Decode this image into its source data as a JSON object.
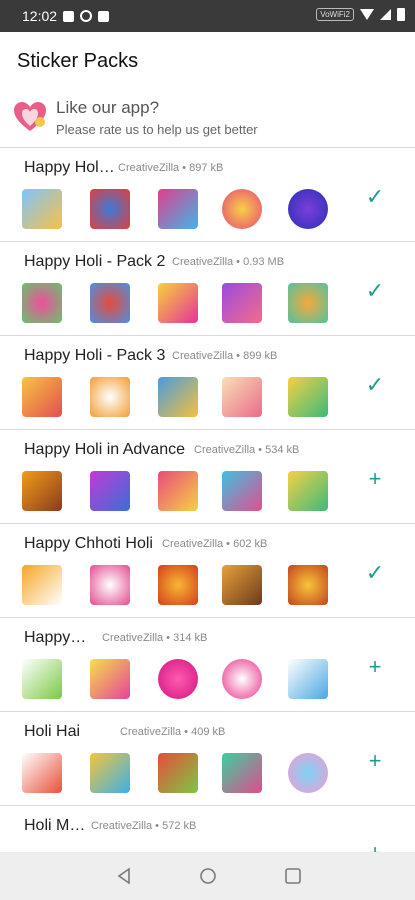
{
  "status_bar": {
    "time": "12:02",
    "vowifi": "VoWiFi2"
  },
  "app_bar": {
    "title": "Sticker Packs"
  },
  "rate_prompt": {
    "title": "Like our app?",
    "subtitle": "Please rate us to help us get better"
  },
  "packs": [
    {
      "title": "Happy Hol…",
      "meta": "CreativeZilla • 897 kB",
      "action": "✓"
    },
    {
      "title": "Happy Holi - Pack 2",
      "meta": "CreativeZilla • 0.93 MB",
      "action": "✓"
    },
    {
      "title": "Happy Holi - Pack 3",
      "meta": "CreativeZilla • 899 kB",
      "action": "✓"
    },
    {
      "title": "Happy Holi in Advance",
      "meta": "CreativeZilla • 534 kB",
      "action": "+"
    },
    {
      "title": "Happy Chhoti Holi",
      "meta": "CreativeZilla • 602 kB",
      "action": "✓"
    },
    {
      "title": "Happy…",
      "meta": "CreativeZilla • 314 kB",
      "action": "+"
    },
    {
      "title": "Holi Hai",
      "meta": "CreativeZilla • 409 kB",
      "action": "+"
    },
    {
      "title": "Holi M…",
      "meta": "CreativeZilla • 572 kB",
      "action": "+"
    }
  ],
  "colors": {
    "accent": "#1f9f8f"
  }
}
